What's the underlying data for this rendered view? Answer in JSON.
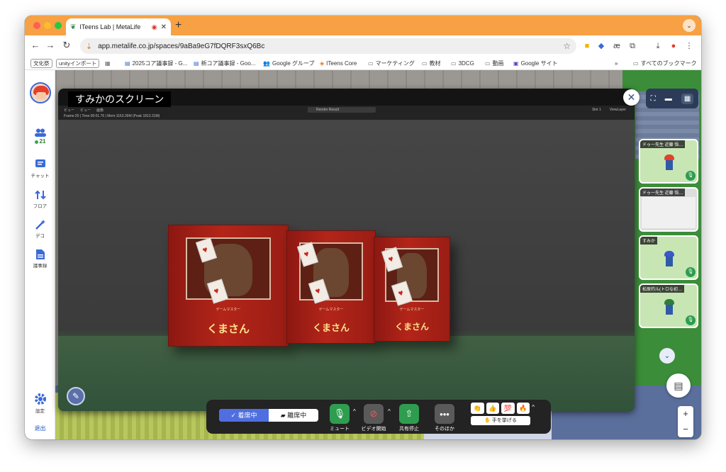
{
  "browser": {
    "tab": {
      "title": "ITeens Lab | MetaLife",
      "favicon": "metalife-icon"
    },
    "new_tab": "+",
    "url": "app.metalife.co.jp/spaces/9aBa9eG7fDQRF3sxQ6Bc",
    "bookmarks": [
      "文化祭",
      "unityインポート",
      "2025コア議事録 - G...",
      "新コア議事録 - Goo...",
      "Google グループ",
      "ITeens Core",
      "マーケティング",
      "教材",
      "3DCG",
      "動画",
      "Google サイト"
    ],
    "bookmarks_overflow": "»",
    "all_bookmarks": "すべてのブックマーク"
  },
  "sidebar": {
    "members_count": "21",
    "items": [
      {
        "label": "チャット",
        "icon": "chat-icon"
      },
      {
        "label": "フロア",
        "icon": "floor-icon"
      },
      {
        "label": "デコ",
        "icon": "deco-icon"
      },
      {
        "label": "議事録",
        "icon": "minutes-icon"
      }
    ],
    "settings": "設定",
    "leave": "退出"
  },
  "screen_share": {
    "title": "すみかのスクリーン",
    "blender": {
      "menus": [
        "ビュー",
        "ビュー",
        "画像"
      ],
      "render_label": "Render Result",
      "slot": "Slot 1",
      "layer": "ViewLayer",
      "stats": "Frame:20 | Time:00:01.76 | Mem:1163.39M (Peak 1813.31M)"
    },
    "box_text": {
      "title": "くまさん",
      "subtitle": "ゲームマスター"
    }
  },
  "participants": [
    {
      "name": "ドゥー先生 近藤 悟…",
      "kind": "avatar",
      "hair": "#e2402a"
    },
    {
      "name": "ドゥー先生 近藤 悟…",
      "kind": "screen",
      "hair": "#e2402a"
    },
    {
      "name": "すみか",
      "kind": "avatar",
      "hair": "#3b57c9"
    },
    {
      "name": "松原灼ル(トロな初…",
      "kind": "avatar",
      "hair": "#2f7d3a"
    }
  ],
  "controls": {
    "present": "着席中",
    "away": "離席中",
    "mute": "ミュート",
    "video": "ビデオ開始",
    "share": "共有停止",
    "more": "そのほか",
    "raise_hand": "✋ 手を挙げる",
    "reactions": [
      "👏",
      "👍",
      "💯",
      "🔥"
    ]
  },
  "colors": {
    "accent": "#4f6fe0",
    "mic_green": "#2e9d4f",
    "tabbar": "#f7a144"
  }
}
